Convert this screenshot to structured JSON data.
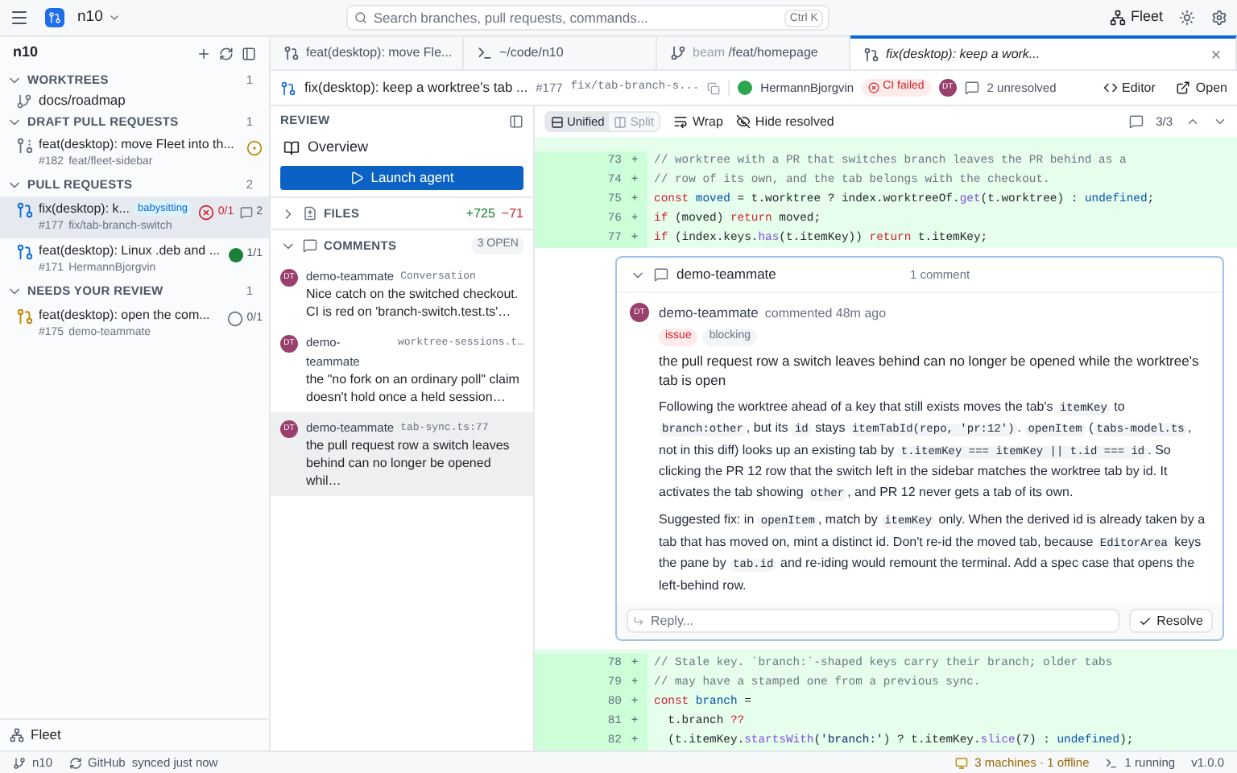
{
  "topbar": {
    "workspace": "n10",
    "search_placeholder": "Search branches, pull requests, commands...",
    "shortcut": "Ctrl K",
    "fleet": "Fleet"
  },
  "sidebar": {
    "title": "n10",
    "sections": [
      {
        "label": "WORKTREES",
        "count": "1",
        "expanded": true,
        "items": [
          {
            "kind": "worktree",
            "title": "docs/roadmap"
          }
        ]
      },
      {
        "label": "DRAFT PULL REQUESTS",
        "count": "1",
        "expanded": true,
        "items": [
          {
            "kind": "draft",
            "title": "feat(desktop): move Fleet into th...",
            "number": "#182",
            "sub": "feat/fleet-sidebar",
            "selected": false,
            "checks": {
              "kind": "pending"
            }
          }
        ]
      },
      {
        "label": "PULL REQUESTS",
        "count": "2",
        "expanded": true,
        "items": [
          {
            "kind": "pr",
            "title": "fix(desktop): k...",
            "badge": "babysitting",
            "number": "#177",
            "sub": "fix/tab-branch-switch",
            "selected": true,
            "checks": {
              "kind": "failed",
              "text": "0/1"
            },
            "comments": "2"
          },
          {
            "kind": "pr",
            "title": "feat(desktop): Linux .deb and ...",
            "number": "#171",
            "sub": "HermannBjorgvin",
            "selected": false,
            "checks": {
              "kind": "passed",
              "text": "1/1"
            }
          }
        ]
      },
      {
        "label": "NEEDS YOUR REVIEW",
        "count": "1",
        "expanded": true,
        "items": [
          {
            "kind": "review",
            "title": "feat(desktop): open the com...",
            "number": "#175",
            "sub": "demo-teammate",
            "selected": false,
            "checks": {
              "kind": "none",
              "text": "0/1"
            }
          }
        ]
      }
    ],
    "footer": "Fleet"
  },
  "tabs": [
    {
      "kind": "pr",
      "label": "feat(desktop): move Fle...",
      "selected": false
    },
    {
      "kind": "terminal",
      "label": "~/code/n10",
      "selected": false
    },
    {
      "kind": "branch",
      "prefix": "beam",
      "label": "/feat/homepage",
      "selected": false
    },
    {
      "kind": "pr",
      "label": "fix(desktop): keep a work...",
      "selected": true,
      "preview": true
    }
  ],
  "pr_header": {
    "title": "fix(desktop): keep a worktree's tab ...",
    "number": "#177",
    "branch": "fix/tab-branch-s...",
    "author": "HermannBjorgvin",
    "ci": "CI failed",
    "reviewer_avatar": "DT",
    "unresolved": "2 unresolved",
    "buttons": [
      "Editor",
      "Open"
    ]
  },
  "review": {
    "title": "REVIEW",
    "overview": "Overview",
    "launch": "Launch agent",
    "files": {
      "label": "FILES",
      "expanded": false,
      "additions": "+725",
      "deletions": "−71"
    },
    "comments": {
      "label": "COMMENTS",
      "expanded": true,
      "count": "3 OPEN",
      "items": [
        {
          "avatar": "DT",
          "author": "demo-teammate",
          "location": "Conversation",
          "text": "Nice catch on the switched checkout. CI is red on 'branch-switch.test.ts'…",
          "selected": false
        },
        {
          "avatar": "DT",
          "author": "demo-teammate",
          "location": "worktree-sessions.t…",
          "text": "the \"no fork on an ordinary poll\" claim doesn't hold once a held session…",
          "selected": false
        },
        {
          "avatar": "DT",
          "author": "demo-teammate",
          "location": "tab-sync.ts:77",
          "text": "the pull request row a switch leaves behind can no longer be opened whil…",
          "selected": true
        }
      ]
    }
  },
  "diff_toolbar": {
    "views": [
      {
        "label": "Unified",
        "selected": true
      },
      {
        "label": "Split",
        "selected": false
      }
    ],
    "wrap": "Wrap",
    "hide_resolved": "Hide resolved",
    "counter": "3/3"
  },
  "diff_before": [
    {
      "number": "73",
      "sign": "+",
      "tokens": [
        {
          "kind": "comment",
          "text": "// worktree with a PR that switches branch leaves the PR behind as a"
        }
      ]
    },
    {
      "number": "74",
      "sign": "+",
      "tokens": [
        {
          "kind": "comment",
          "text": "// row of its own, and the tab belongs with the checkout."
        }
      ]
    },
    {
      "number": "75",
      "sign": "+",
      "tokens": [
        {
          "kind": "kw",
          "text": "const"
        },
        {
          "kind": "var",
          "text": " moved"
        },
        {
          "kind": "plain",
          "text": " = t.worktree ? index.worktreeOf."
        },
        {
          "kind": "fn",
          "text": "get"
        },
        {
          "kind": "plain",
          "text": "(t.worktree) : "
        },
        {
          "kind": "const",
          "text": "undefined"
        },
        {
          "kind": "plain",
          "text": ";"
        }
      ]
    },
    {
      "number": "76",
      "sign": "+",
      "tokens": [
        {
          "kind": "kw",
          "text": "if"
        },
        {
          "kind": "plain",
          "text": " (moved) "
        },
        {
          "kind": "kw",
          "text": "return"
        },
        {
          "kind": "plain",
          "text": " moved;"
        }
      ]
    },
    {
      "number": "77",
      "sign": "+",
      "tokens": [
        {
          "kind": "kw",
          "text": "if"
        },
        {
          "kind": "plain",
          "text": " (index.keys."
        },
        {
          "kind": "fn",
          "text": "has"
        },
        {
          "kind": "plain",
          "text": "(t.itemKey)) "
        },
        {
          "kind": "kw",
          "text": "return"
        },
        {
          "kind": "plain",
          "text": " t.itemKey;"
        }
      ]
    }
  ],
  "thread": {
    "author": "demo-teammate",
    "count": "1 comment",
    "expanded": true,
    "comment": {
      "avatar": "DT",
      "author": "demo-teammate",
      "time": "commented 48m ago",
      "tags": [
        {
          "kind": "issue",
          "label": "issue"
        },
        {
          "kind": "plain",
          "label": "blocking"
        }
      ],
      "title": "the pull request row a switch leaves behind can no longer be opened while the worktree's tab is open",
      "paragraphs": [
        [
          {
            "kind": "text",
            "text": "Following the worktree ahead of a key that still exists moves the tab's "
          },
          {
            "kind": "code",
            "text": "itemKey"
          },
          {
            "kind": "text",
            "text": " to "
          },
          {
            "kind": "code",
            "text": "branch:other"
          },
          {
            "kind": "text",
            "text": ", but its "
          },
          {
            "kind": "code",
            "text": "id"
          },
          {
            "kind": "text",
            "text": " stays "
          },
          {
            "kind": "code",
            "text": "itemTabId(repo, 'pr:12')"
          },
          {
            "kind": "text",
            "text": ". "
          },
          {
            "kind": "code",
            "text": "openItem"
          },
          {
            "kind": "text",
            "text": " ("
          },
          {
            "kind": "code",
            "text": "tabs-model.ts"
          },
          {
            "kind": "text",
            "text": ", not in this diff) looks up an existing tab by "
          },
          {
            "kind": "code",
            "text": "t.itemKey === itemKey || t.id === id"
          },
          {
            "kind": "text",
            "text": ". So clicking the PR 12 row that the switch left in the sidebar matches the worktree tab by id. It activates the tab showing "
          },
          {
            "kind": "code",
            "text": "other"
          },
          {
            "kind": "text",
            "text": ", and PR 12 never gets a tab of its own."
          }
        ],
        [
          {
            "kind": "text",
            "text": "Suggested fix: in "
          },
          {
            "kind": "code",
            "text": "openItem"
          },
          {
            "kind": "text",
            "text": ", match by "
          },
          {
            "kind": "code",
            "text": "itemKey"
          },
          {
            "kind": "text",
            "text": " only. When the derived id is already taken by a tab that has moved on, mint a distinct id. Don't re-id the moved tab, because "
          },
          {
            "kind": "code",
            "text": "EditorArea"
          },
          {
            "kind": "text",
            "text": " keys the pane by "
          },
          {
            "kind": "code",
            "text": "tab.id"
          },
          {
            "kind": "text",
            "text": " and re-iding would remount the terminal. Add a spec case that opens the left-behind row."
          }
        ]
      ]
    },
    "reply_placeholder": "Reply...",
    "resolve": "Resolve"
  },
  "diff_after": [
    {
      "number": "78",
      "sign": "+",
      "tokens": [
        {
          "kind": "comment",
          "text": "// Stale key. `branch:`-shaped keys carry their branch; older tabs"
        }
      ]
    },
    {
      "number": "79",
      "sign": "+",
      "tokens": [
        {
          "kind": "comment",
          "text": "// may have a stamped one from a previous sync."
        }
      ]
    },
    {
      "number": "80",
      "sign": "+",
      "tokens": [
        {
          "kind": "kw",
          "text": "const"
        },
        {
          "kind": "var",
          "text": " branch"
        },
        {
          "kind": "plain",
          "text": " ="
        }
      ]
    },
    {
      "number": "81",
      "sign": "+",
      "tokens": [
        {
          "kind": "plain",
          "text": "  t.branch "
        },
        {
          "kind": "kw",
          "text": "??"
        }
      ]
    },
    {
      "number": "82",
      "sign": "+",
      "tokens": [
        {
          "kind": "plain",
          "text": "  (t.itemKey."
        },
        {
          "kind": "fn",
          "text": "startsWith"
        },
        {
          "kind": "plain",
          "text": "("
        },
        {
          "kind": "str",
          "text": "'branch:'"
        },
        {
          "kind": "plain",
          "text": ") ? t.itemKey."
        },
        {
          "kind": "fn",
          "text": "slice"
        },
        {
          "kind": "plain",
          "text": "(7) : "
        },
        {
          "kind": "const",
          "text": "undefined"
        },
        {
          "kind": "plain",
          "text": ");"
        }
      ]
    }
  ],
  "status_bar": {
    "workspace": "n10",
    "provider": "GitHub",
    "sync": "synced just now",
    "machines": "3 machines · 1 offline",
    "running": "1 running",
    "version": "v1.0.0"
  }
}
